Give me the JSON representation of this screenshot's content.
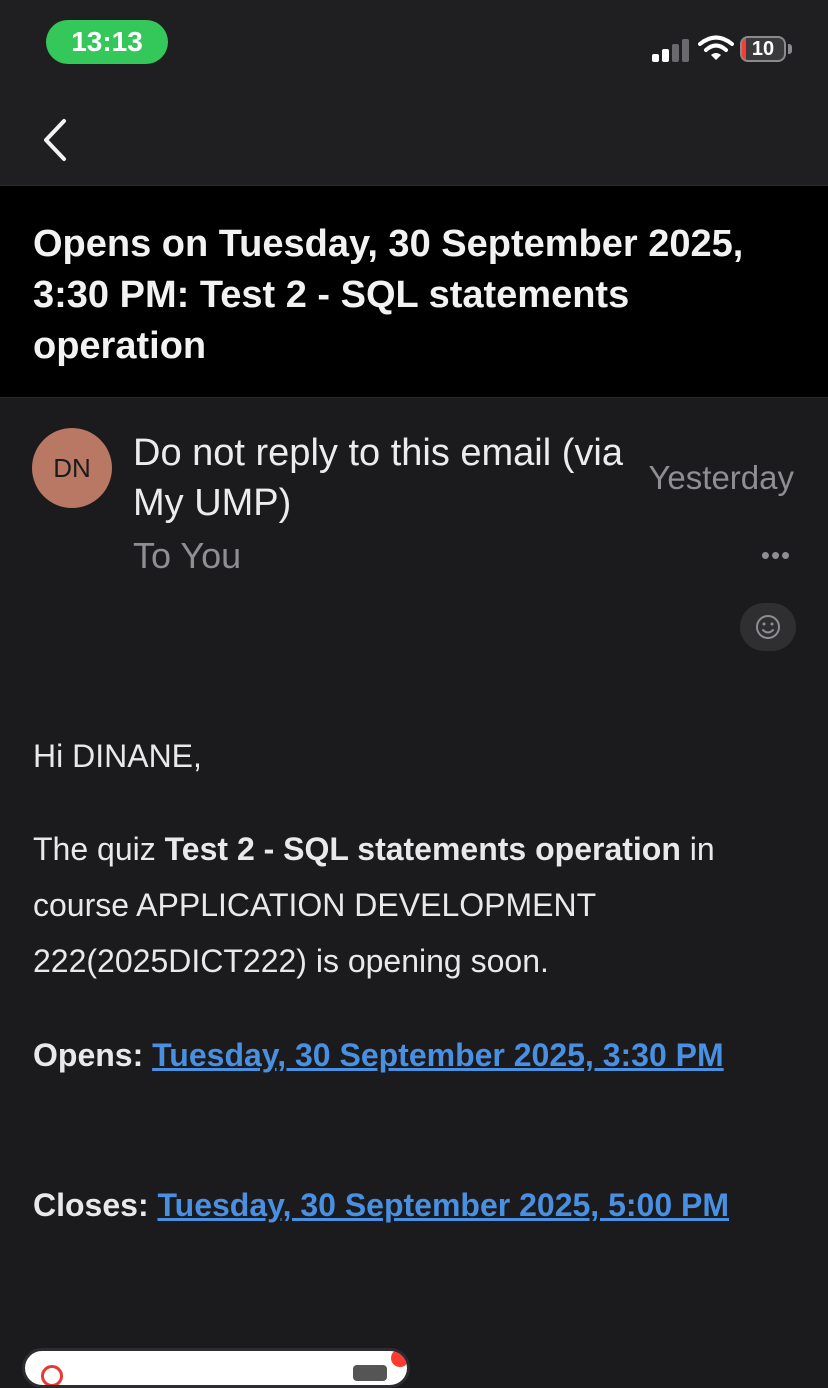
{
  "status_bar": {
    "time": "13:13",
    "battery_level": "10"
  },
  "email": {
    "subject": "Opens on Tuesday, 30 September 2025, 3:30 PM: Test 2 - SQL statements operation",
    "sender": {
      "initials": "DN",
      "name": "Do not reply to this email (via My UMP)",
      "recipient": "To You"
    },
    "date": "Yesterday",
    "more_label": "•••",
    "body": {
      "greeting": "Hi DINANE,",
      "intro_before": "The quiz ",
      "quiz_name": "Test 2 - SQL statements operation",
      "intro_after": " in course APPLICATION DEVELOPMENT 222(2025DICT222) is opening soon.",
      "opens_label": "Opens:",
      "opens_value": "Tuesday, 30 September 2025, 3:30 PM",
      "closes_label": "Closes:",
      "closes_value": "Tuesday, 30 September 2025, 5:00 PM"
    }
  },
  "colors": {
    "accent_link": "#4a90e2",
    "time_pill": "#34c759",
    "avatar": "#b97864",
    "background": "#1b1b1d"
  },
  "icons": {
    "back": "chevron-left-icon",
    "signal": "cellular-signal-icon",
    "wifi": "wifi-icon",
    "battery": "battery-icon",
    "more": "more-horizontal-icon",
    "react": "emoji-smile-icon"
  }
}
